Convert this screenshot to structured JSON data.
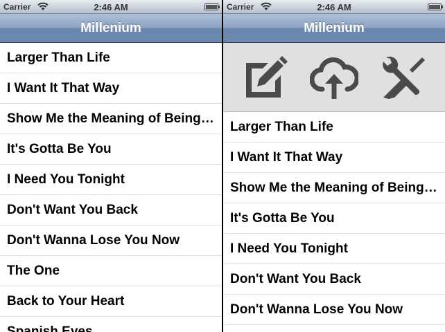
{
  "status": {
    "carrier": "Carrier",
    "time": "2:46 AM"
  },
  "left": {
    "title": "Millenium",
    "songs": [
      "Larger Than Life",
      "I Want It That Way",
      "Show Me the Meaning of Being Lonely",
      "It's Gotta Be You",
      "I Need You Tonight",
      "Don't Want You Back",
      "Don't Wanna Lose You Now",
      "The One",
      "Back to Your Heart",
      "Spanish Eyes"
    ]
  },
  "right": {
    "title": "Millenium",
    "toolbar": {
      "icons": [
        "edit-icon",
        "cloud-upload-icon",
        "tools-icon"
      ],
      "icon_color": "#4a4a4a"
    },
    "songs": [
      "Larger Than Life",
      "I Want It That Way",
      "Show Me the Meaning of Being Lonely",
      "It's Gotta Be You",
      "I Need You Tonight",
      "Don't Want You Back",
      "Don't Wanna Lose You Now"
    ]
  }
}
